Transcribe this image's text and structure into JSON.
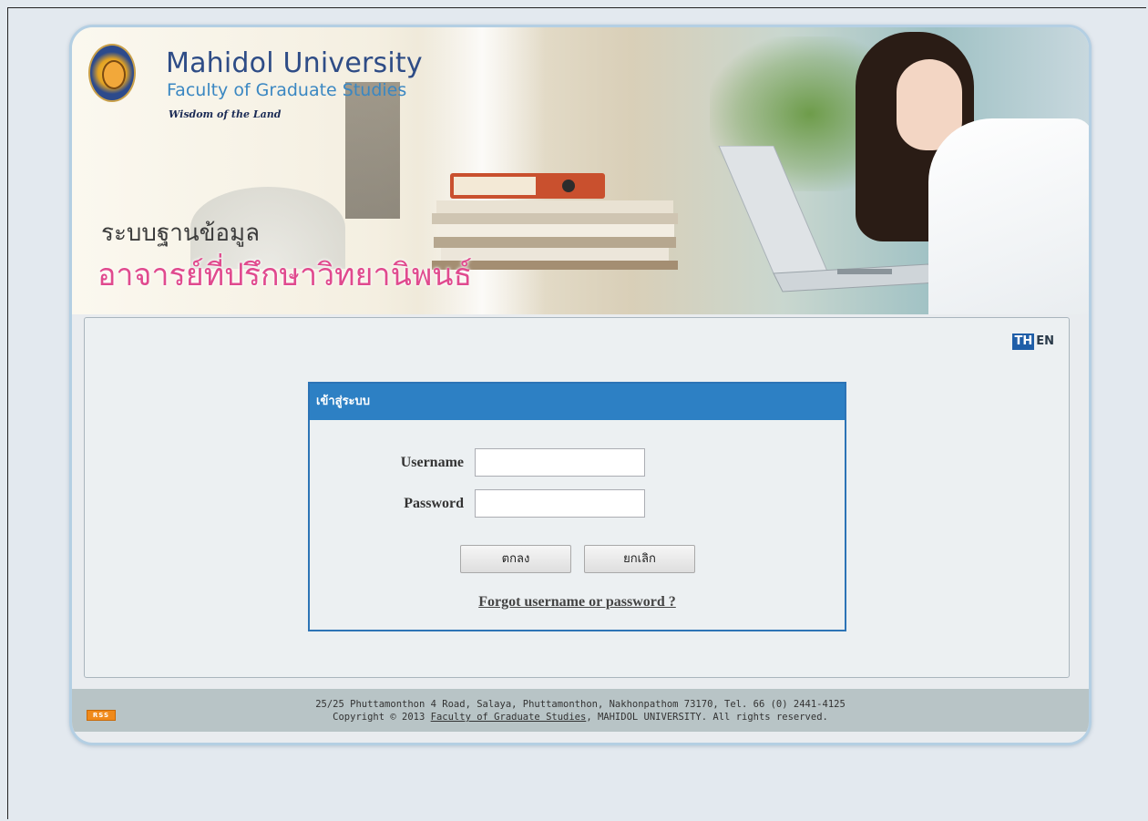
{
  "header": {
    "university": "Mahidol University",
    "faculty": "Faculty of Graduate Studies",
    "tagline": "Wisdom of the Land",
    "thai_line_1": "ระบบฐานข้อมูล",
    "thai_line_2": "อาจารย์ที่ปรึกษาวิทยานิพนธ์"
  },
  "language": {
    "th_label": "TH",
    "en_label": "EN"
  },
  "login": {
    "title": "เข้าสู่ระบบ",
    "username_label": "Username",
    "username_value": "",
    "password_label": "Password",
    "password_value": "",
    "ok_label": "ตกลง",
    "cancel_label": "ยกเลิก",
    "forgot_label": "Forgot username or password ?"
  },
  "footer": {
    "rss_label": "RSS",
    "address": "25/25 Phuttamonthon 4 Road, Salaya, Phuttamonthon, Nakhonpathom 73170, Tel. 66 (0) 2441-4125",
    "copyright_prefix": "Copyright © 2013",
    "copyright_link": "Faculty of Graduate Studies",
    "copyright_suffix": ", MAHIDOL UNIVERSITY. All rights reserved."
  },
  "colors": {
    "header_blue": "#2d80c4",
    "pink_title": "#e04a8e",
    "page_bg": "#e3e9ef"
  }
}
